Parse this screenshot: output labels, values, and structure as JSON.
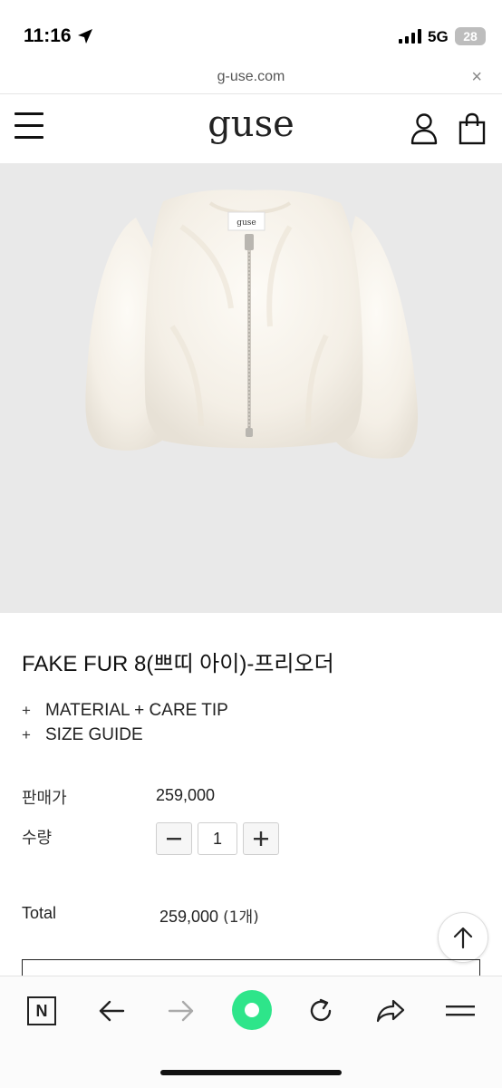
{
  "status_bar": {
    "time": "11:16",
    "network": "5G",
    "battery": "28"
  },
  "browser": {
    "url": "g-use.com",
    "close_label": "×"
  },
  "header": {
    "logo": "guse"
  },
  "product": {
    "image_label": "guse",
    "title": "FAKE FUR 8(쁘띠 아이)-프리오더",
    "accordion": [
      {
        "icon": "+",
        "label": "MATERIAL + CARE TIP"
      },
      {
        "icon": "+",
        "label": "SIZE GUIDE"
      }
    ],
    "price_label": "판매가",
    "price": "259,000",
    "qty_label": "수량",
    "qty_value": "1",
    "total_label": "Total",
    "total_value": "259,000",
    "total_count": "(1개)"
  },
  "colors": {
    "image_bg": "#e9e9e9",
    "accent_green": "#2ee58a"
  },
  "toolbar": {
    "icons": [
      "naver-n-icon",
      "back-arrow-icon",
      "forward-arrow-icon",
      "green-dot-icon",
      "reload-icon",
      "share-icon",
      "menu-icon"
    ],
    "naver_label": "N"
  }
}
